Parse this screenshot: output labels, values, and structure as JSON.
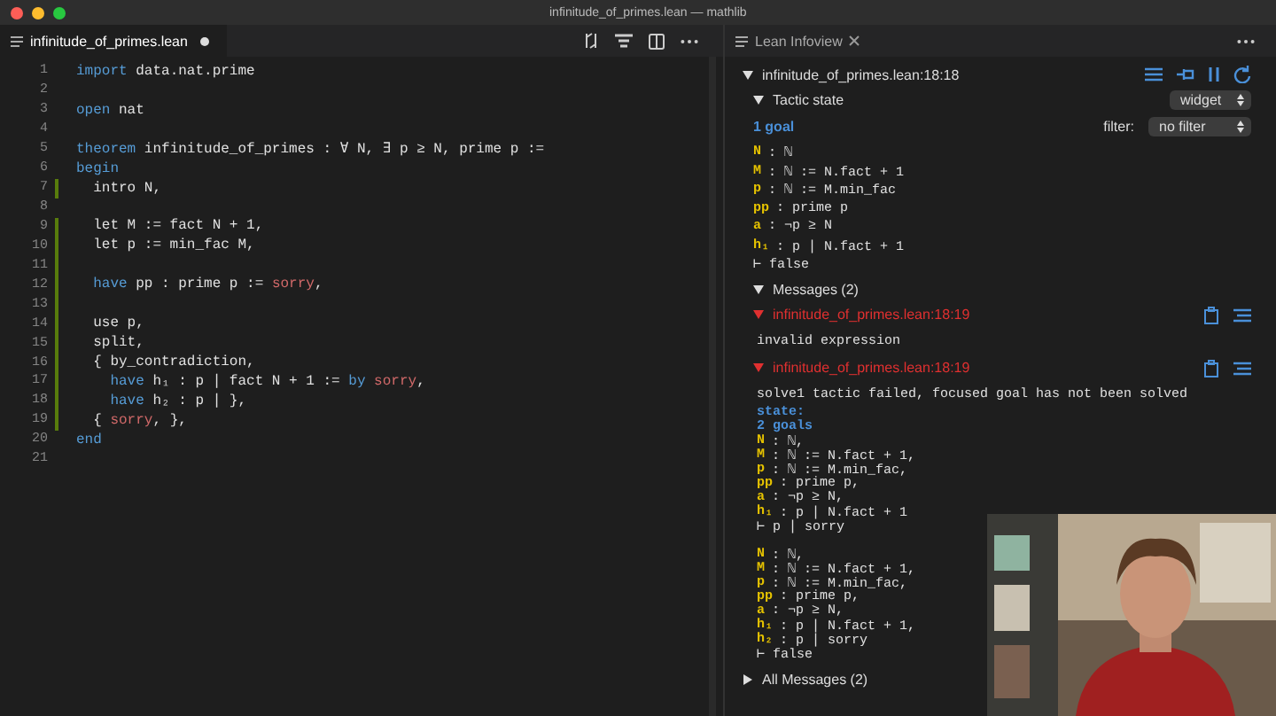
{
  "window": {
    "title": "infinitude_of_primes.lean — mathlib"
  },
  "editor": {
    "tab": {
      "label": "infinitude_of_primes.lean",
      "modified": true
    },
    "lines": [
      {
        "n": "1",
        "modified": false,
        "segs": [
          {
            "t": "import",
            "kind": "kw"
          },
          {
            "t": " data.nat.prime",
            "kind": "id"
          }
        ]
      },
      {
        "n": "2",
        "modified": false
      },
      {
        "n": "3",
        "modified": false,
        "segs": [
          {
            "t": "open",
            "kind": "kw"
          },
          {
            "t": " nat",
            "kind": "id"
          }
        ]
      },
      {
        "n": "4",
        "modified": false
      },
      {
        "n": "5",
        "modified": false,
        "segs": [
          {
            "t": "theorem",
            "kind": "kw"
          },
          {
            "t": " infinitude_of_primes : ∀ N, ∃ p ≥ N, prime p :=",
            "kind": "id"
          }
        ]
      },
      {
        "n": "6",
        "modified": false,
        "segs": [
          {
            "t": "begin",
            "kind": "kw"
          }
        ]
      },
      {
        "n": "7",
        "modified": true,
        "segs": [
          {
            "t": "  intro N,",
            "kind": "id"
          }
        ]
      },
      {
        "n": "8",
        "modified": false
      },
      {
        "n": "9",
        "modified": true,
        "segs": [
          {
            "t": "  let M := fact N + 1,",
            "kind": "id"
          }
        ]
      },
      {
        "n": "10",
        "modified": true,
        "segs": [
          {
            "t": "  let p := min_fac M,",
            "kind": "id"
          }
        ]
      },
      {
        "n": "11",
        "modified": true
      },
      {
        "n": "12",
        "modified": true,
        "segs": [
          {
            "t": "  have",
            "kind": "kw"
          },
          {
            "t": " pp : prime p := ",
            "kind": "id"
          },
          {
            "t": "sorry",
            "kind": "err"
          },
          {
            "t": ",",
            "kind": "id"
          }
        ]
      },
      {
        "n": "13",
        "modified": true
      },
      {
        "n": "14",
        "modified": true,
        "segs": [
          {
            "t": "  use p,",
            "kind": "id"
          }
        ]
      },
      {
        "n": "15",
        "modified": true,
        "segs": [
          {
            "t": "  split,",
            "kind": "id"
          }
        ]
      },
      {
        "n": "16",
        "modified": true,
        "segs": [
          {
            "t": "  { by_contradiction,",
            "kind": "id"
          }
        ]
      },
      {
        "n": "17",
        "modified": true,
        "segs": [
          {
            "t": "    have",
            "kind": "kw"
          },
          {
            "t": " h₁ : p ∣ fact N + 1 := ",
            "kind": "id"
          },
          {
            "t": "by",
            "kind": "kw"
          },
          {
            "t": " sorry",
            "kind": "err"
          },
          {
            "t": ",",
            "kind": "id"
          }
        ]
      },
      {
        "n": "18",
        "modified": true,
        "segs": [
          {
            "t": "    have",
            "kind": "kw"
          },
          {
            "t": " h₂ : p ∣ },",
            "kind": "id"
          }
        ]
      },
      {
        "n": "19",
        "modified": true,
        "segs": [
          {
            "t": "  { ",
            "kind": "id"
          },
          {
            "t": "sorry",
            "kind": "err"
          },
          {
            "t": ", },",
            "kind": "id"
          }
        ]
      },
      {
        "n": "20",
        "modified": false,
        "segs": [
          {
            "t": "end",
            "kind": "kw"
          }
        ]
      },
      {
        "n": "21",
        "modified": false
      }
    ]
  },
  "infoview": {
    "tab": {
      "label": "Lean Infoview"
    },
    "location": {
      "label": "infinitude_of_primes.lean:18:18",
      "expanded": true
    },
    "tactic_state": {
      "label": "Tactic state",
      "expanded": true,
      "view": "widget",
      "goal_count": "1 goal",
      "filter_label": "filter:",
      "filter": "no filter",
      "lines": [
        {
          "kind": "hyp",
          "name": "N",
          "rest": ": ℕ"
        },
        {
          "kind": "hyp",
          "name": "M",
          "rest": ": ℕ := N.fact + 1"
        },
        {
          "kind": "hyp",
          "name": "p",
          "rest": ": ℕ := M.min_fac"
        },
        {
          "kind": "hyp",
          "name": "pp",
          "rest": ": prime p"
        },
        {
          "kind": "hyp",
          "name": "a",
          "rest": ": ¬p ≥ N"
        },
        {
          "kind": "hyp",
          "name": "h₁",
          "rest": ": p ∣ N.fact + 1"
        },
        {
          "kind": "goal",
          "text": "⊢ false"
        }
      ]
    },
    "messages": {
      "label": "Messages (2)",
      "expanded": true,
      "items": [
        {
          "location": "infinitude_of_primes.lean:18:19",
          "expanded": true,
          "lines": [
            {
              "kind": "text",
              "text": "invalid expression"
            }
          ]
        },
        {
          "location": "infinitude_of_primes.lean:18:19",
          "expanded": true,
          "lines": [
            {
              "kind": "text",
              "text": "solve1 tactic failed, focused goal has not been solved"
            },
            {
              "kind": "heading",
              "text": "state:"
            },
            {
              "kind": "heading",
              "text": "2 goals"
            },
            {
              "kind": "hyp",
              "name": "N",
              "rest": ": ℕ,"
            },
            {
              "kind": "hyp",
              "name": "M",
              "rest": ": ℕ := N.fact + 1,"
            },
            {
              "kind": "hyp",
              "name": "p",
              "rest": ": ℕ := M.min_fac,"
            },
            {
              "kind": "hyp",
              "name": "pp",
              "rest": ": prime p,"
            },
            {
              "kind": "hyp",
              "name": "a",
              "rest": ": ¬p ≥ N,"
            },
            {
              "kind": "hyp",
              "name": "h₁",
              "rest": ": p ∣ N.fact + 1"
            },
            {
              "kind": "goal",
              "text": "⊢ p ∣ sorry"
            },
            {
              "kind": "gap"
            },
            {
              "kind": "hyp",
              "name": "N",
              "rest": ": ℕ,"
            },
            {
              "kind": "hyp",
              "name": "M",
              "rest": ": ℕ := N.fact + 1,"
            },
            {
              "kind": "hyp",
              "name": "p",
              "rest": ": ℕ := M.min_fac,"
            },
            {
              "kind": "hyp",
              "name": "pp",
              "rest": ": prime p,"
            },
            {
              "kind": "hyp",
              "name": "a",
              "rest": ": ¬p ≥ N,"
            },
            {
              "kind": "hyp",
              "name": "h₁",
              "rest": ": p ∣ N.fact + 1,"
            },
            {
              "kind": "hyp",
              "name": "h₂",
              "rest": ": p ∣ sorry"
            },
            {
              "kind": "goal",
              "text": "⊢ false"
            }
          ]
        }
      ]
    },
    "all_messages": {
      "label": "All Messages (2)",
      "expanded": false
    }
  }
}
